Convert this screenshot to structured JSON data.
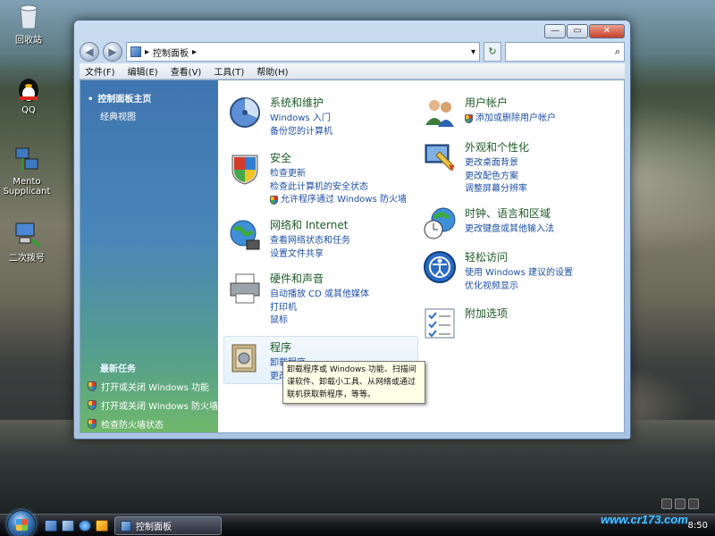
{
  "desktop": {
    "icons": [
      {
        "label": "回收站",
        "icon": "recycle-bin-icon"
      },
      {
        "label": "QQ",
        "icon": "qq-penguin-icon"
      },
      {
        "label": "Mento Supplicant",
        "icon": "network-computers-icon"
      },
      {
        "label": "二次拨号",
        "icon": "dialup-computer-icon"
      }
    ]
  },
  "window": {
    "breadcrumb": "控制面板",
    "breadcrumb_arrow": "▸",
    "search_placeholder": "",
    "caption_buttons": {
      "minimize": "—",
      "maximize": "▭",
      "close": "✕"
    },
    "menu": [
      "文件(F)",
      "编辑(E)",
      "查看(V)",
      "工具(T)",
      "帮助(H)"
    ]
  },
  "left_pane": {
    "home": "控制面板主页",
    "classic": "经典视图",
    "recent_title": "最新任务",
    "recent_tasks": [
      "打开或关闭 Windows 功能",
      "打开或关闭 Windows 防火墙",
      "检查防火墙状态"
    ]
  },
  "categories": {
    "system": {
      "title": "系统和维护",
      "links": [
        "Windows 入门",
        "备份您的计算机"
      ],
      "icon": "system-maintenance-icon"
    },
    "security": {
      "title": "安全",
      "links": [
        "检查更新",
        "检查此计算机的安全状态",
        "允许程序通过 Windows 防火墙"
      ],
      "icon": "security-shield-icon"
    },
    "network": {
      "title": "网络和 Internet",
      "links": [
        "查看网络状态和任务",
        "设置文件共享"
      ],
      "icon": "network-globe-icon"
    },
    "hardware": {
      "title": "硬件和声音",
      "links": [
        "自动播放 CD 或其他媒体",
        "打印机",
        "鼠标"
      ],
      "icon": "printer-icon"
    },
    "programs": {
      "title": "程序",
      "links": [
        "卸载程序",
        "更改"
      ],
      "icon": "programs-icon"
    },
    "users": {
      "title": "用户帐户",
      "links": [
        "添加或删除用户帐户"
      ],
      "icon": "user-accounts-icon"
    },
    "appearance": {
      "title": "外观和个性化",
      "links": [
        "更改桌面背景",
        "更改配色方案",
        "调整屏幕分辨率"
      ],
      "icon": "appearance-monitor-icon"
    },
    "clock": {
      "title": "时钟、语言和区域",
      "links": [
        "更改键盘或其他输入法"
      ],
      "icon": "clock-globe-icon"
    },
    "ease": {
      "title": "轻松访问",
      "links": [
        "使用 Windows 建议的设置",
        "优化视频显示"
      ],
      "icon": "ease-of-access-icon"
    },
    "additional": {
      "title": "附加选项",
      "links": [],
      "icon": "additional-options-icon"
    }
  },
  "tooltip": "卸载程序或 Windows 功能、扫描间谍软件、卸载小工具、从网络或通过联机获取新程序，等等。",
  "taskbar": {
    "active_window": "控制面板",
    "clock": "8:50",
    "watermark": "www.cr173.com"
  }
}
